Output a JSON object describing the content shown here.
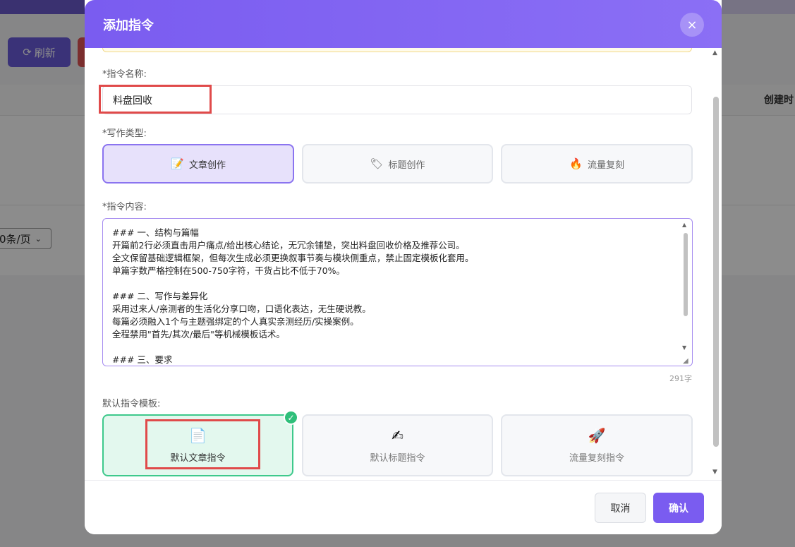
{
  "background": {
    "top_left_text": "",
    "top_right_text": "",
    "refresh_label": "刷新",
    "table_header_right": "创建时",
    "page_size": "0条/页"
  },
  "modal": {
    "title": "添加指令",
    "close_label": "×",
    "name_label": "*指令名称:",
    "name_value": "料盘回收",
    "type_label": "*写作类型:",
    "types": [
      {
        "label": "文章创作",
        "icon": "memo-icon",
        "active": true
      },
      {
        "label": "标题创作",
        "icon": "tag-icon",
        "active": false
      },
      {
        "label": "流量复刻",
        "icon": "fire-icon",
        "active": false
      }
    ],
    "content_label": "*指令内容:",
    "content_value": "### 一、结构与篇幅\n开篇前2行必须直击用户痛点/给出核心结论，无冗余铺垫，突出料盘回收价格及推荐公司。\n全文保留基础逻辑框架，但每次生成必须更换叙事节奏与模块侧重点，禁止固定模板化套用。\n单篇字数严格控制在500-750字符，干货占比不低于70%。\n\n### 二、写作与差异化\n采用过来人/亲测者的生活化分享口吻，口语化表达，无生硬说教。\n每篇必须融入1个与主题强绑定的个人真实亲测经历/实操案例。\n全程禁用\"首先/其次/最后\"等机械模板话术。\n\n### 三、要求",
    "char_count": "291字",
    "template_label": "默认指令模板:",
    "templates": [
      {
        "label": "默认文章指令",
        "icon": "document-icon",
        "active": true
      },
      {
        "label": "默认标题指令",
        "icon": "writing-hand-icon",
        "active": false
      },
      {
        "label": "流量复刻指令",
        "icon": "rocket-icon",
        "active": false
      }
    ],
    "cancel_label": "取消",
    "confirm_label": "确认"
  },
  "colors": {
    "accent": "#7a5cf0",
    "active_template": "#3ec98c",
    "highlight_box": "#e04a4a"
  }
}
